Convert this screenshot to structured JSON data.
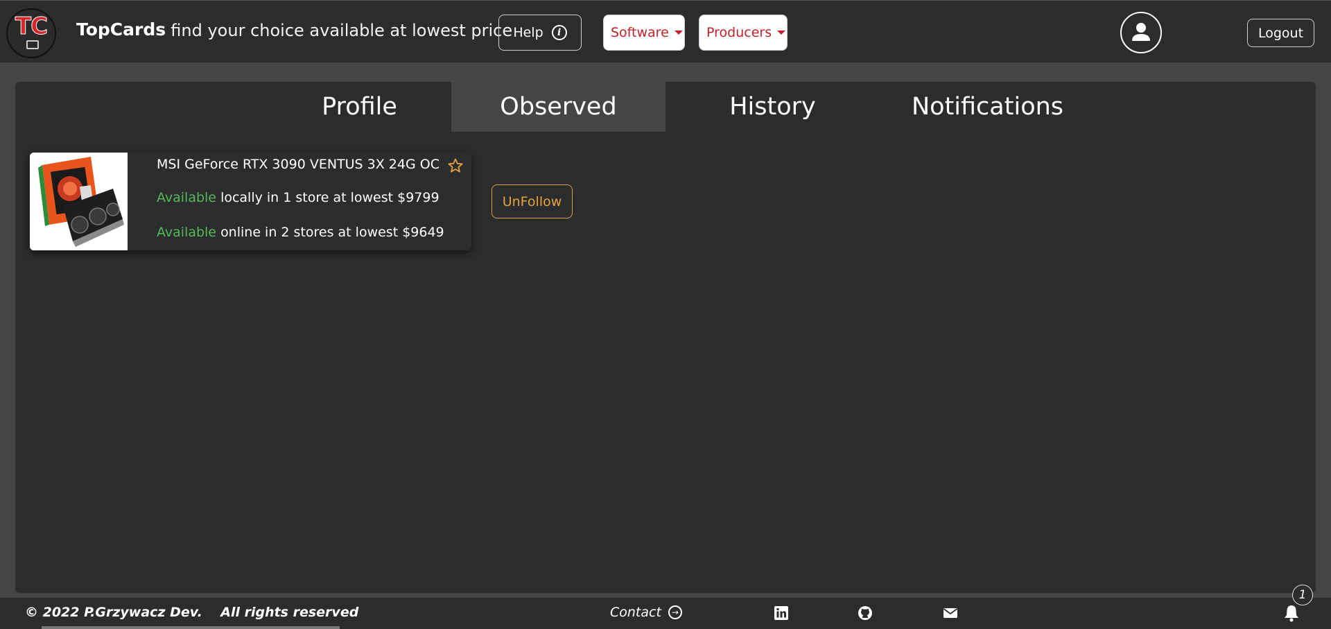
{
  "header": {
    "logo_text": "TC",
    "brand": "TopCards",
    "tagline": "- find your choice available at lowest price",
    "help_label": "Help",
    "software_label": "Software",
    "producers_label": "Producers",
    "logout_label": "Logout"
  },
  "tabs": [
    {
      "label": "Profile",
      "active": false
    },
    {
      "label": "Observed",
      "active": true
    },
    {
      "label": "History",
      "active": false
    },
    {
      "label": "Notifications",
      "active": false
    }
  ],
  "observed": [
    {
      "title": "MSI GeForce RTX 3090 VENTUS 3X 24G OC",
      "local_status": "Available",
      "local_text": "locally in 1 store at lowest $9799",
      "online_status": "Available",
      "online_text": "online in 2 stores at lowest $9649",
      "unfollow_label": "UnFollow"
    }
  ],
  "footer": {
    "copyright": "© 2022 P.Grzywacz Dev.    All rights reserved",
    "contact_label": "Contact",
    "notification_count": "1"
  },
  "colors": {
    "accent_red": "#c0222a",
    "available_green": "#57b857",
    "unfollow_orange": "#e8a33b",
    "panel_bg": "#2b2c2e",
    "page_bg": "#454545"
  }
}
